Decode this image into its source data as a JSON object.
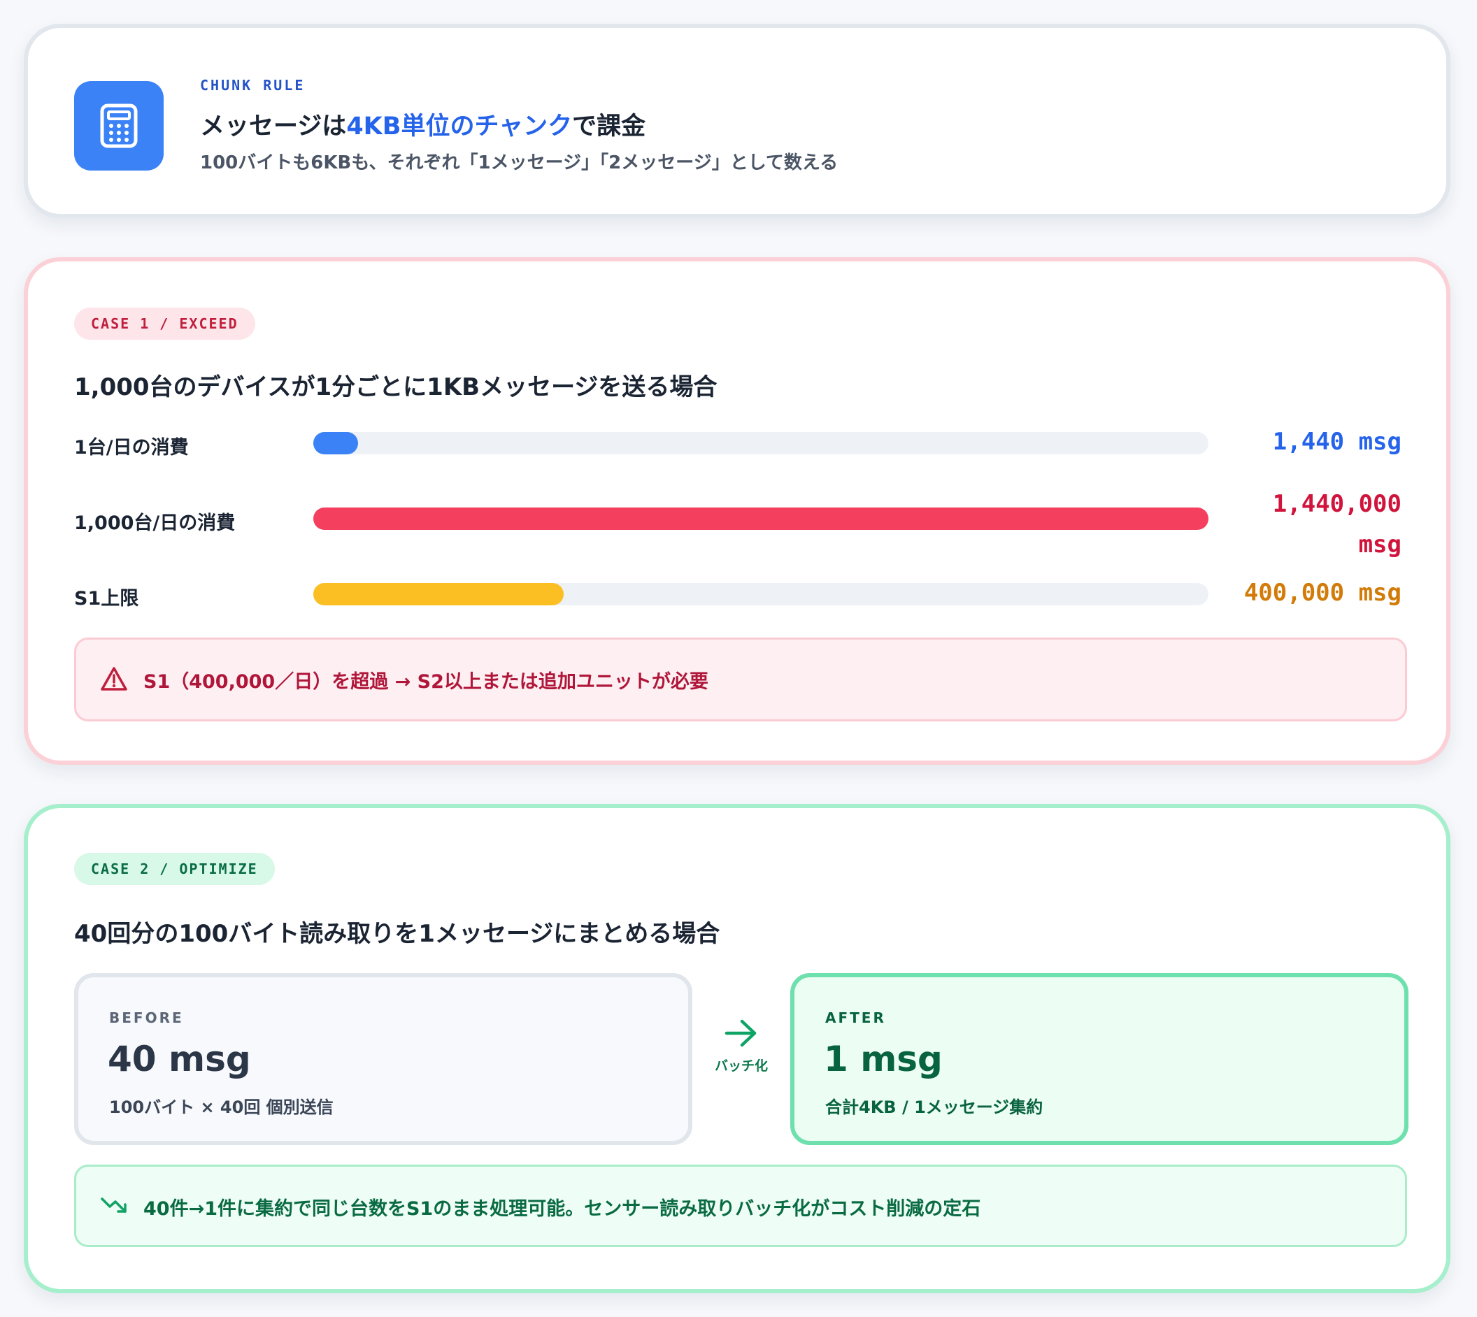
{
  "chunk_rule": {
    "eyebrow": "CHUNK RULE",
    "title_prefix": "メッセージは",
    "title_highlight": "4KB単位のチャンク",
    "title_suffix": "で課金",
    "subtitle": "100バイトも6KBも、それぞれ「1メッセージ」「2メッセージ」として数える",
    "icon": "calculator-icon"
  },
  "case1": {
    "badge": "CASE 1 / EXCEED",
    "title": "1,000台のデバイスが1分ごとに1KBメッセージを送る場合",
    "rows": [
      {
        "label": "1台/日の消費",
        "value": "1,440 msg",
        "amount": 1440,
        "color": "#3b82f6",
        "text_color": "#2563eb"
      },
      {
        "label": "1,000台/日の消費",
        "value_line1": "1,440,000",
        "value_line2": "msg",
        "amount": 1440000,
        "color": "#f43f5e",
        "text_color": "#d0143c"
      },
      {
        "label": "S1上限",
        "value": "400,000 msg",
        "amount": 400000,
        "color": "#fbbf24",
        "text_color": "#d27b09"
      }
    ],
    "alert": {
      "icon": "warning-triangle-icon",
      "text": "S1（400,000／日）を超過 → S2以上または追加ユニットが必要"
    }
  },
  "case2": {
    "badge": "CASE 2 / OPTIMIZE",
    "title": "40回分の100バイト読み取りを1メッセージにまとめる場合",
    "before": {
      "eyebrow": "BEFORE",
      "value": "40 msg",
      "desc": "100バイト × 40回 個別送信"
    },
    "arrow": {
      "icon": "arrow-right-icon",
      "label": "バッチ化"
    },
    "after": {
      "eyebrow": "AFTER",
      "value": "1 msg",
      "desc": "合計4KB / 1メッセージ集約"
    },
    "alert": {
      "icon": "trending-down-icon",
      "text": "40件→1件に集約で同じ台数をS1のまま処理可能。センサー読み取りバッチ化がコスト削減の定石"
    }
  }
}
